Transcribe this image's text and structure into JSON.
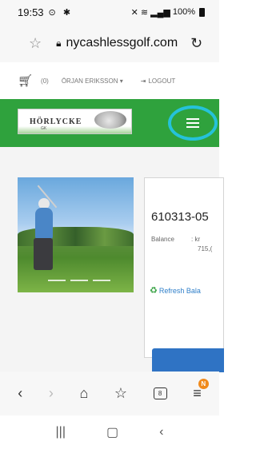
{
  "status_bar": {
    "time": "19:53",
    "battery": "100%"
  },
  "address_bar": {
    "url": "nycashlessgolf.com"
  },
  "site_nav": {
    "cart_count": "(0)",
    "user_name": "ÖRJAN ERIKSSON ▾",
    "logout_label": "LOGOUT"
  },
  "header": {
    "logo_text": "HÖRLYCKE",
    "logo_sub": "GK"
  },
  "account": {
    "id": "610313-05",
    "balance_label": "Balance",
    "balance_currency": ": kr",
    "balance_value": "715,(",
    "refresh_label": "Refresh Bala"
  },
  "browser_toolbar": {
    "tab_count": "8",
    "menu_badge": "N"
  },
  "colors": {
    "header_green": "#2fa23d",
    "highlight_ring": "#25c2d9",
    "link_blue": "#2f7fc9",
    "button_blue": "#2f73c4"
  }
}
